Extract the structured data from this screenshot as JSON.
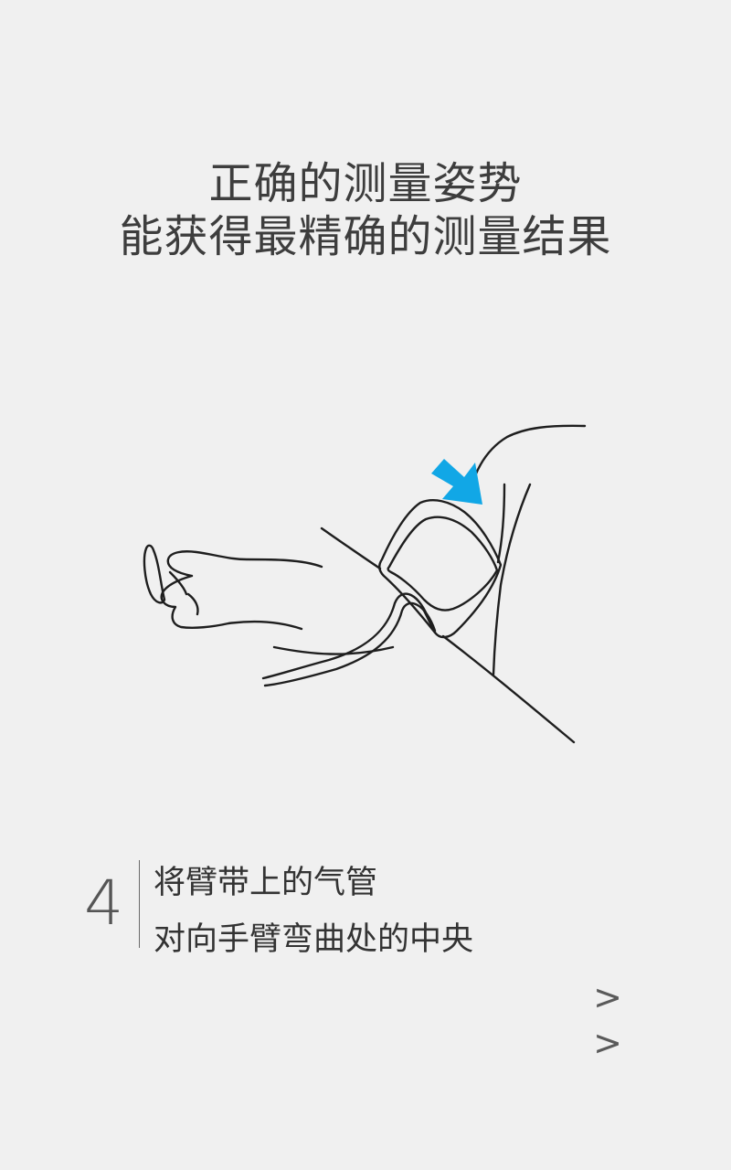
{
  "header": {
    "line1": "正确的测量姿势",
    "line2": "能获得最精确的测量结果"
  },
  "illustration": {
    "arrow_color": "#11a7e6"
  },
  "step": {
    "number": "4",
    "line1": "将臂带上的气管",
    "line2": "对向手臂弯曲处的中央"
  },
  "navigation": {
    "next_label": "> >"
  }
}
